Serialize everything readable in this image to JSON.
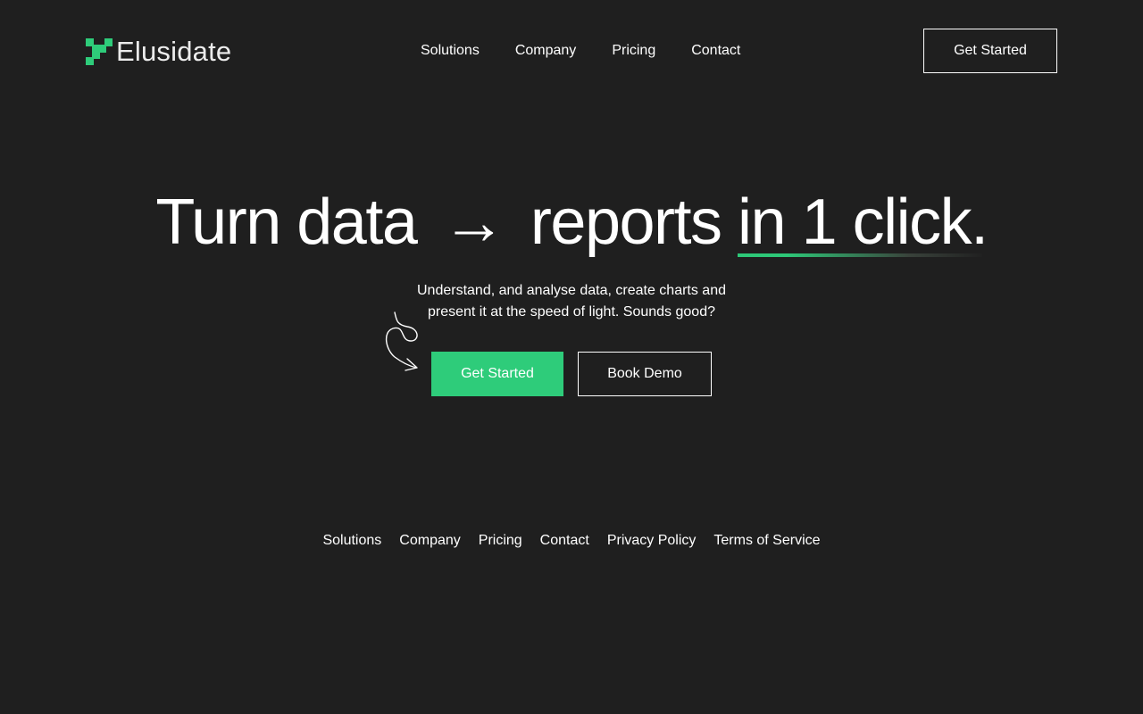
{
  "brand": {
    "name": "Elusidate",
    "accent_color": "#2ecc7a",
    "logo_icon": "pixel-mark-icon"
  },
  "header": {
    "nav": [
      {
        "label": "Solutions"
      },
      {
        "label": "Company"
      },
      {
        "label": "Pricing"
      },
      {
        "label": "Contact"
      }
    ],
    "cta_label": "Get Started"
  },
  "hero": {
    "title_part1": "Turn data",
    "title_arrow": "→",
    "title_part2": "reports",
    "title_highlight": "in 1 click.",
    "subtitle": "Understand, and analyse data, create charts and present it at the speed of light. Sounds good?",
    "primary_label": "Get Started",
    "secondary_label": "Book Demo",
    "doodle_icon": "curly-arrow-icon"
  },
  "footer": {
    "links": [
      {
        "label": "Solutions"
      },
      {
        "label": "Company"
      },
      {
        "label": "Pricing"
      },
      {
        "label": "Contact"
      },
      {
        "label": "Privacy Policy"
      },
      {
        "label": "Terms of Service"
      }
    ]
  }
}
